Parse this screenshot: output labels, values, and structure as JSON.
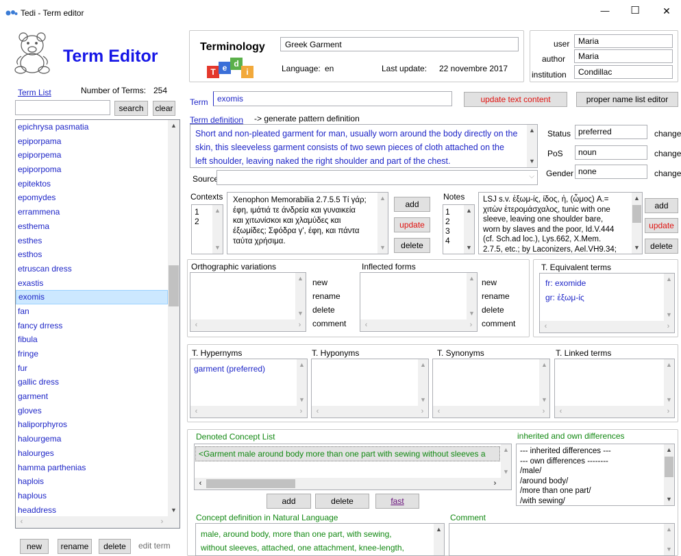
{
  "window": {
    "title": "Tedi - Term editor",
    "min": "—",
    "max": "☐",
    "close": "✕"
  },
  "app": {
    "heading": "Term Editor"
  },
  "termlist": {
    "label": "Term List",
    "count_label": "Number of Terms:",
    "count": "254",
    "search_btn": "search",
    "clear_btn": "clear",
    "items": [
      "epichrysa pasmatia",
      "epiporpama",
      "epiporpema",
      "epiporpoma",
      "epitektos",
      "epomydes",
      "errammena",
      "esthema",
      "esthes",
      "esthos",
      "etruscan dress",
      "exastis",
      "exomis",
      "fan",
      "fancy drress",
      "fibula",
      "fringe",
      "fur",
      "gallic dress",
      "garment",
      "gloves",
      "haliporphyros",
      "halourgema",
      "halourges",
      "hamma parthenias",
      "haplois",
      "haplous",
      "headdress"
    ],
    "selected_index": 12,
    "new_btn": "new",
    "rename_btn": "rename",
    "delete_btn": "delete",
    "edit_label": "edit term"
  },
  "terminology": {
    "label": "Terminology",
    "name": "Greek Garment",
    "language_label": "Language:",
    "language": "en",
    "update_label": "Last update:",
    "update": "22 novembre 2017",
    "logo_letters": [
      "T",
      "e",
      "d",
      "i"
    ]
  },
  "user": {
    "user_label": "user",
    "user": "Maria",
    "author_label": "author",
    "author": "Maria",
    "institution_label": "institution",
    "institution": "Condillac"
  },
  "term": {
    "label": "Term",
    "value": "exomis",
    "update_btn": "update text content",
    "proper_btn": "proper name list editor",
    "definition_label": "Term definition",
    "generate_label": "-> generate pattern definition",
    "definition": [
      "Short and non-pleated garment for man, usually worn around the body directly on the",
      "skin, this sleeveless garment consists of two sewn pieces of cloth attached on the",
      "left shoulder, leaving naked the right shoulder and part of the chest."
    ],
    "source_label": "Source"
  },
  "props": {
    "status_label": "Status",
    "status": "preferred",
    "pos_label": "PoS",
    "pos": "noun",
    "gender_label": "Gender",
    "gender": "none",
    "change": "change"
  },
  "contexts": {
    "label": "Contexts",
    "indices": [
      "1",
      "2"
    ],
    "text": [
      "Xenophon Memorabilia 2.7.5.5 Τί γάρ;",
      "έφη, ιμάτιά τε άνδρεία και γυναικεία",
      "και χιτωνίσκοι και χλαμύδες και",
      "έξωμίδες; Σφόδρα γ', έφη, και πάντα",
      "ταύτα χρήσιμα."
    ],
    "add": "add",
    "update": "update",
    "delete": "delete"
  },
  "notes": {
    "label": "Notes",
    "indices": [
      "1",
      "2",
      "3",
      "4"
    ],
    "text": [
      "LSJ s.v. ἐξωμ-ίς, ίδος, ἡ, (ὦμος) A.=",
      "χιτὼν ἑτερομάσχαλος, tunic with one",
      "sleeve, leaving one shoulder bare,",
      "worn by slaves and the poor, Id.V.444",
      "(cf. Sch.ad loc.), Lys.662, X.Mem.",
      "2.7.5, etc.; by Laconizers, Ael.VH9.34;"
    ],
    "add": "add",
    "update": "update",
    "delete": "delete"
  },
  "ortho": {
    "label": "Orthographic variations",
    "new": "new",
    "rename": "rename",
    "delete": "delete",
    "comment": "comment"
  },
  "inflected": {
    "label": "Inflected forms",
    "new": "new",
    "rename": "rename",
    "delete": "delete",
    "comment": "comment"
  },
  "equivalent": {
    "label": "T. Equivalent terms",
    "items": [
      "fr: exomide",
      "gr: ἐξωμ-ίς"
    ]
  },
  "relations": {
    "hypernyms_label": "T. Hypernyms",
    "hypernyms": [
      "garment (preferred)"
    ],
    "hyponyms_label": "T. Hyponyms",
    "synonyms_label": "T. Synonyms",
    "linked_label": "T. Linked terms"
  },
  "concept": {
    "label": "Denoted Concept List",
    "item": "<Garment male around body more than one part with sewing without sleeves a",
    "add": "add",
    "delete": "delete",
    "fast": "fast",
    "diff_label": "inherited and own differences",
    "diffs": [
      "--- inherited differences ---",
      "--- own differences --------",
      "/male/",
      "/around body/",
      "/more than one part/",
      "/with sewing/"
    ],
    "nl_label": "Concept definition in Natural Language",
    "nl_text": [
      "male, around body, more than one part, with sewing,",
      "without sleeves, attached, one attachment, knee-length,"
    ],
    "comment_label": "Comment"
  },
  "colors": {
    "accent_blue": "#1d25c7",
    "alert_red": "#e0120f",
    "concept_green": "#118811",
    "selection": "#cce8ff"
  }
}
